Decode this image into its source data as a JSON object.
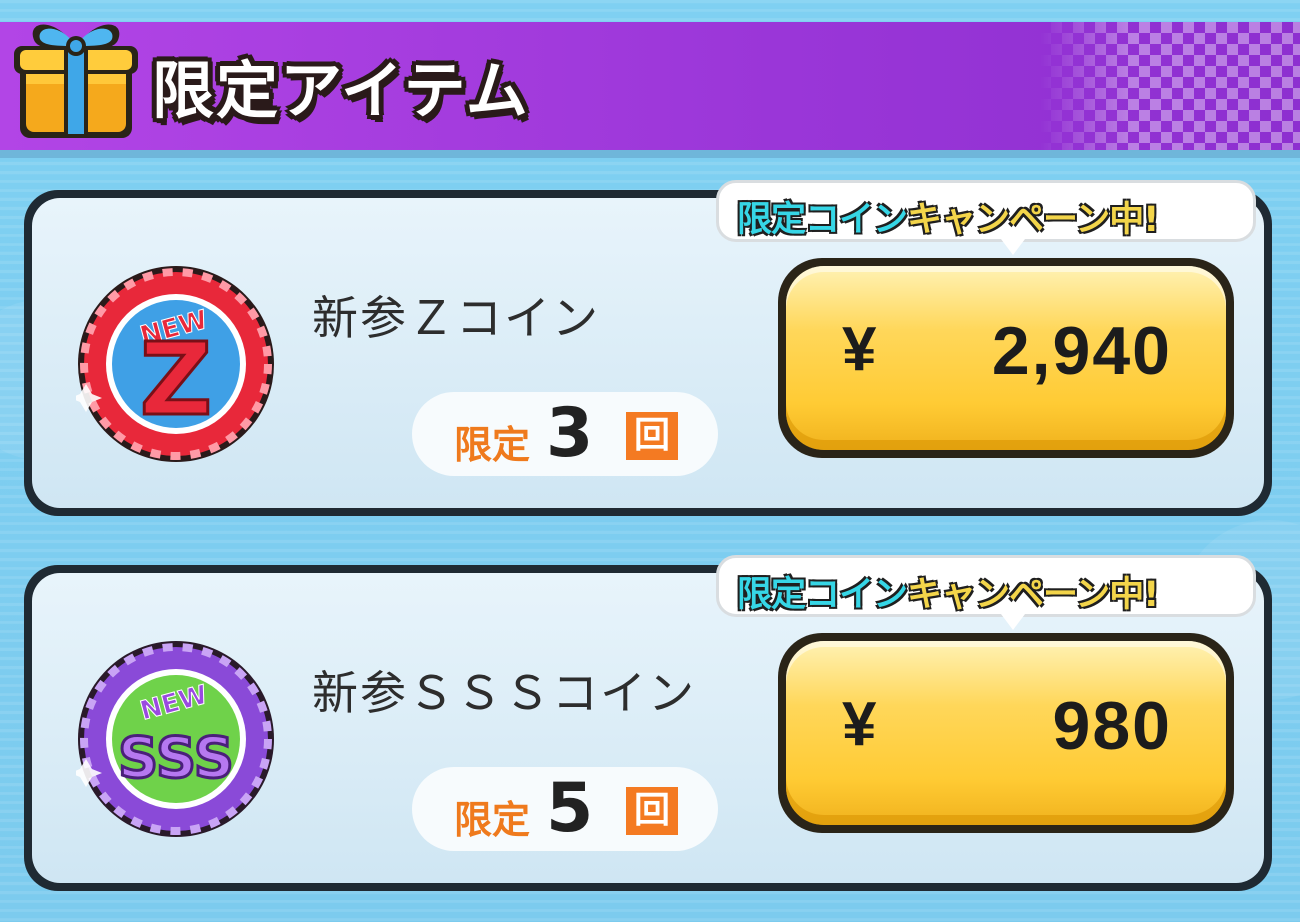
{
  "header": {
    "title": "限定アイテム",
    "icon": "gift-icon"
  },
  "items": [
    {
      "name": "新参ＺコインZ",
      "coin_icon": "new-z-coin-icon",
      "limit_label": "限定",
      "limit_count": "3",
      "limit_suffix": "回",
      "campaign_part1": "限定コイン",
      "campaign_part2": "キャンペーン中!",
      "currency": "¥",
      "price": "2,940"
    },
    {
      "name": "新参ＳＳＳコイン",
      "coin_icon": "new-sss-coin-icon",
      "limit_label": "限定",
      "limit_count": "5",
      "limit_suffix": "回",
      "campaign_part1": "限定コイン",
      "campaign_part2": "キャンペーン中!",
      "currency": "¥",
      "price": "980"
    }
  ],
  "colors": {
    "header_purple": "#a63ee0",
    "background_blue": "#7fd0f2",
    "price_gold": "#ffd75a",
    "limit_orange": "#f47a22",
    "campaign_cyan": "#36d6e6",
    "campaign_yellow": "#f3d54a"
  }
}
